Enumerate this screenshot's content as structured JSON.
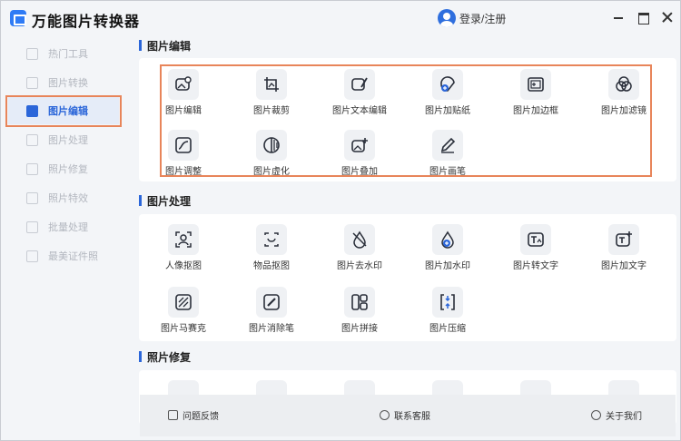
{
  "app": {
    "title": "万能图片转换器",
    "login_label": "登录/注册"
  },
  "window_controls": {
    "minimize": "minimize-icon",
    "maximize": "maximize-icon",
    "close": "close-icon"
  },
  "sidebar": {
    "items": [
      {
        "label": "热门工具",
        "icon": "flame-icon"
      },
      {
        "label": "图片转换",
        "icon": "convert-icon"
      },
      {
        "label": "图片编辑",
        "icon": "edit-icon",
        "active": true
      },
      {
        "label": "图片处理",
        "icon": "process-icon"
      },
      {
        "label": "照片修复",
        "icon": "repair-icon"
      },
      {
        "label": "照片特效",
        "icon": "effects-icon"
      },
      {
        "label": "批量处理",
        "icon": "batch-icon"
      },
      {
        "label": "最美证件照",
        "icon": "id-photo-icon"
      }
    ]
  },
  "sections": {
    "edit": {
      "title": "图片编辑",
      "tools": [
        "图片编辑",
        "图片裁剪",
        "图片文本编辑",
        "图片加贴纸",
        "图片加边框",
        "图片加滤镜",
        "图片调整",
        "图片虚化",
        "图片叠加",
        "图片画笔"
      ]
    },
    "process": {
      "title": "图片处理",
      "tools": [
        "人像抠图",
        "物品抠图",
        "图片去水印",
        "图片加水印",
        "图片转文字",
        "图片加文字",
        "图片马赛克",
        "图片消除笔",
        "图片拼接",
        "图片压缩"
      ]
    },
    "repair": {
      "title": "照片修复"
    }
  },
  "footer": {
    "feedback": "问题反馈",
    "contact": "联系客服",
    "about": "关于我们"
  },
  "colors": {
    "accent": "#2b66d9",
    "highlight_border": "#e8855a"
  }
}
